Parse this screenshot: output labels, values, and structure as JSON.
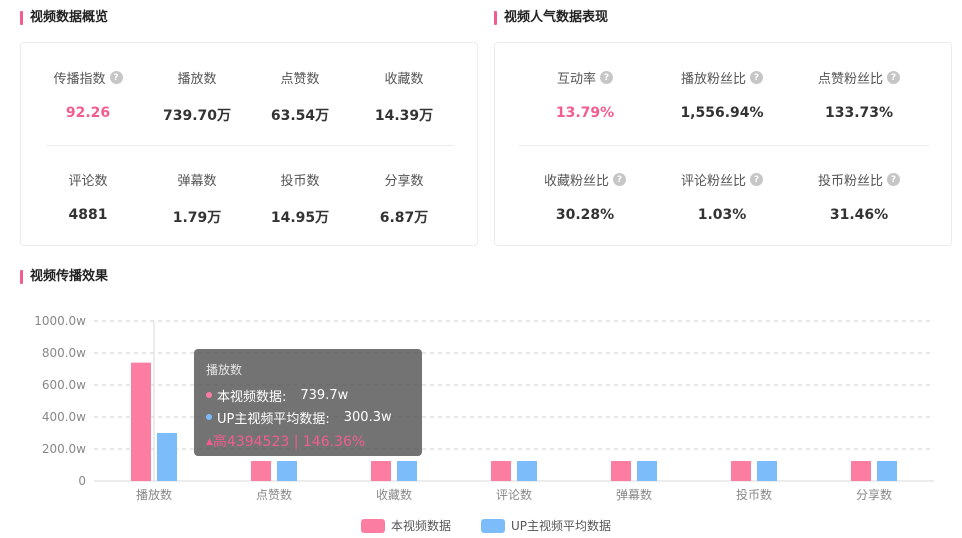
{
  "overview": {
    "title": "视频数据概览",
    "row1": [
      {
        "label": "传播指数",
        "value": "92.26",
        "help": true,
        "highlight": true
      },
      {
        "label": "播放数",
        "value": "739.70万"
      },
      {
        "label": "点赞数",
        "value": "63.54万"
      },
      {
        "label": "收藏数",
        "value": "14.39万"
      }
    ],
    "row2": [
      {
        "label": "评论数",
        "value": "4881"
      },
      {
        "label": "弹幕数",
        "value": "1.79万"
      },
      {
        "label": "投币数",
        "value": "14.95万"
      },
      {
        "label": "分享数",
        "value": "6.87万"
      }
    ]
  },
  "popularity": {
    "title": "视频人气数据表现",
    "row1": [
      {
        "label": "互动率",
        "value": "13.79%",
        "help": true,
        "highlight": true
      },
      {
        "label": "播放粉丝比",
        "value": "1,556.94%",
        "help": true
      },
      {
        "label": "点赞粉丝比",
        "value": "133.73%",
        "help": true
      }
    ],
    "row2": [
      {
        "label": "收藏粉丝比",
        "value": "30.28%",
        "help": true
      },
      {
        "label": "评论粉丝比",
        "value": "1.03%",
        "help": true
      },
      {
        "label": "投币粉丝比",
        "value": "31.46%",
        "help": true
      }
    ]
  },
  "effect": {
    "title": "视频传播效果"
  },
  "help_icon": "question-mark-icon",
  "colors": {
    "accent": "#f25d8e",
    "series_video": "#fb7da2",
    "series_avg": "#7cbcfa"
  },
  "tooltip": {
    "title": "播放数",
    "row1_name": "本视频数据:",
    "row1_value": "739.7w",
    "row2_name": "UP主视频平均数据:",
    "row2_value": "300.3w",
    "diff": "高4394523 | 146.36%"
  },
  "chart_data": {
    "type": "bar",
    "categories": [
      "播放数",
      "点赞数",
      "收藏数",
      "评论数",
      "弹幕数",
      "投币数",
      "分享数"
    ],
    "y_ticks": [
      "0",
      "200.0w",
      "400.0w",
      "600.0w",
      "800.0w",
      "1000.0w"
    ],
    "ylim": [
      0,
      1000
    ],
    "grid": true,
    "legend_position": "bottom-center",
    "series": [
      {
        "name": "本视频数据",
        "color": "#fb7da2",
        "values": [
          739.7,
          63.54,
          14.39,
          0.49,
          1.79,
          14.95,
          6.87
        ]
      },
      {
        "name": "UP主视频平均数据",
        "color": "#7cbcfa",
        "values": [
          300.3,
          25.8,
          5.84,
          0.2,
          0.73,
          6.07,
          2.79
        ]
      }
    ]
  }
}
